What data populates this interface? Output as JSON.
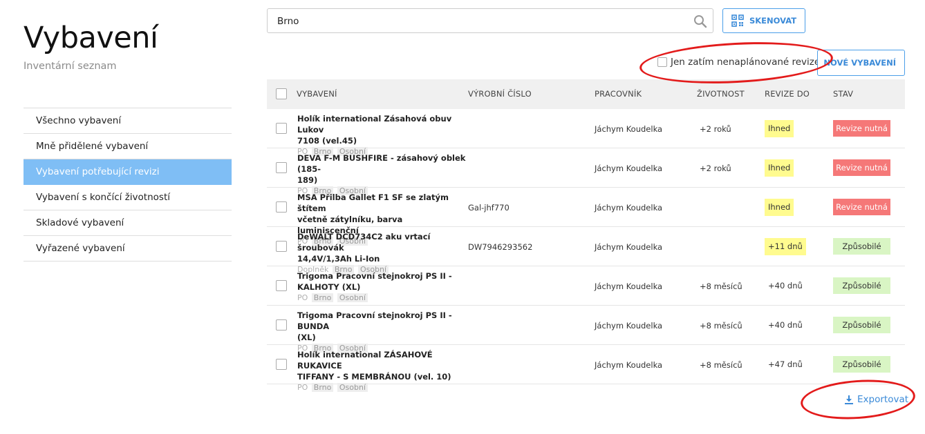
{
  "header": {
    "title": "Vybavení",
    "subtitle": "Inventární seznam"
  },
  "sidebar": {
    "items": [
      {
        "label": "Všechno vybavení",
        "active": false
      },
      {
        "label": "Mně přidělené vybavení",
        "active": false
      },
      {
        "label": "Vybavení potřebující revizi",
        "active": true
      },
      {
        "label": "Vybavení s končící životností",
        "active": false
      },
      {
        "label": "Skladové vybavení",
        "active": false
      },
      {
        "label": "Vyřazené vybavení",
        "active": false
      }
    ]
  },
  "search": {
    "value": "Brno",
    "placeholder": ""
  },
  "toolbar": {
    "scan_label": "SKENOVAT",
    "filter_label": "Jen zatím nenaplánované revize",
    "new_label": "NOVÉ VYBAVENÍ",
    "export_label": "Exportovat"
  },
  "table": {
    "columns": [
      "VYBAVENÍ",
      "VÝROBNÍ ČÍSLO",
      "PRACOVNÍK",
      "ŽIVOTNOST",
      "REVIZE DO",
      "STAV"
    ],
    "rows": [
      {
        "name_line1": "Holík international Zásahová obuv Lukov",
        "name_line2": "7108 (vel.45)",
        "category": "PO",
        "tag1": "Brno",
        "tag2": "Osobní",
        "serial": "",
        "worker": "Jáchym Koudelka",
        "life": "+2 roků",
        "revision": "Ihned",
        "revision_highlight": true,
        "status": "Revize nutná",
        "status_type": "bad"
      },
      {
        "name_line1": "DEVA F-M BUSHFIRE - zásahový oblek (185-",
        "name_line2": "189)",
        "category": "PO",
        "tag1": "Brno",
        "tag2": "Osobní",
        "serial": "",
        "worker": "Jáchym Koudelka",
        "life": "+2 roků",
        "revision": "Ihned",
        "revision_highlight": true,
        "status": "Revize nutná",
        "status_type": "bad"
      },
      {
        "name_line1": "MSA Přilba Gallet F1 SF se zlatým štítem",
        "name_line2": "včetně zátylníku, barva luminiscenční",
        "category": "PO",
        "tag1": "Brno",
        "tag2": "Osobní",
        "serial": "Gal-jhf770",
        "worker": "Jáchym Koudelka",
        "life": "",
        "revision": "Ihned",
        "revision_highlight": true,
        "status": "Revize nutná",
        "status_type": "bad"
      },
      {
        "name_line1": "DeWALT DCD734C2 aku vrtací šroubovák",
        "name_line2": "14,4V/1,3Ah Li-Ion",
        "category": "Doplněk",
        "tag1": "Brno",
        "tag2": "Osobní",
        "serial": "DW7946293562",
        "worker": "Jáchym Koudelka",
        "life": "",
        "revision": "+11 dnů",
        "revision_highlight": true,
        "status": "Způsobilé",
        "status_type": "ok"
      },
      {
        "name_line1": "Trigoma Pracovní stejnokroj PS II -",
        "name_line2": "KALHOTY (XL)",
        "category": "PO",
        "tag1": "Brno",
        "tag2": "Osobní",
        "serial": "",
        "worker": "Jáchym Koudelka",
        "life": "+8 měsíců",
        "revision": "+40 dnů",
        "revision_highlight": false,
        "status": "Způsobilé",
        "status_type": "ok"
      },
      {
        "name_line1": "Trigoma Pracovní stejnokroj PS II - BUNDA",
        "name_line2": "(XL)",
        "category": "PO",
        "tag1": "Brno",
        "tag2": "Osobní",
        "serial": "",
        "worker": "Jáchym Koudelka",
        "life": "+8 měsíců",
        "revision": "+40 dnů",
        "revision_highlight": false,
        "status": "Způsobilé",
        "status_type": "ok"
      },
      {
        "name_line1": "Holík international ZÁSAHOVÉ RUKAVICE",
        "name_line2": "TIFFANY - S MEMBRÁNOU (vel. 10)",
        "category": "PO",
        "tag1": "Brno",
        "tag2": "Osobní",
        "serial": "",
        "worker": "Jáchym Koudelka",
        "life": "+8 měsíců",
        "revision": "+47 dnů",
        "revision_highlight": false,
        "status": "Způsobilé",
        "status_type": "ok"
      }
    ]
  },
  "colors": {
    "accent": "#3a8ad8",
    "active_nav": "#7fbef5",
    "status_bad": "#f57878",
    "status_ok": "#d9f5c4",
    "revision_highlight": "#fffb8f",
    "annotation": "#e31b1b"
  },
  "icons": {
    "search": "search-icon",
    "scan": "qr-code-icon",
    "export": "download-icon"
  }
}
